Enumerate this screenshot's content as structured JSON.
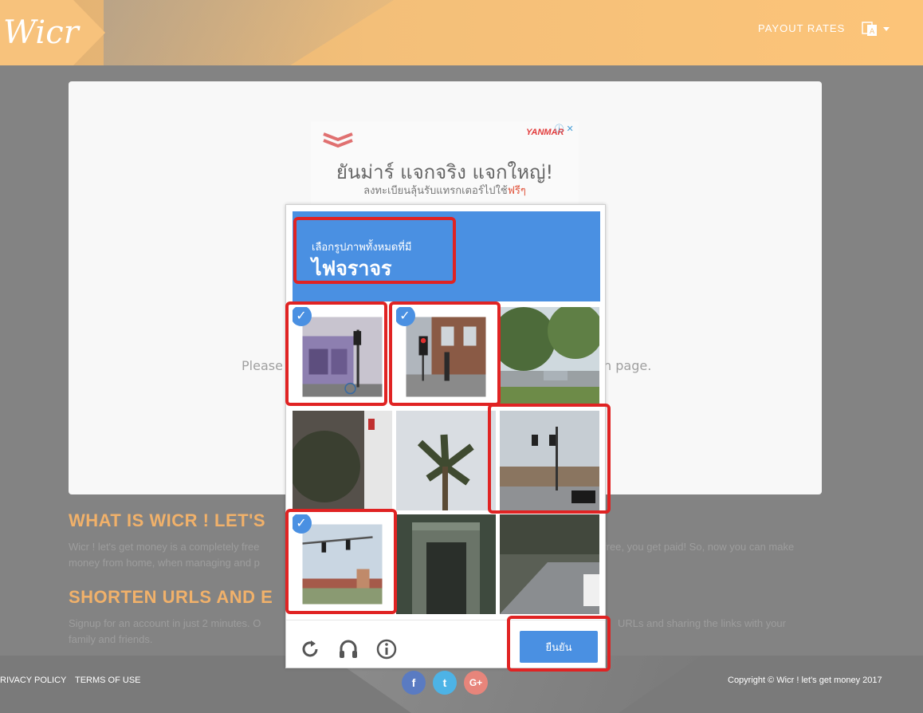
{
  "header": {
    "logo": "Wicr",
    "nav_payout": "PAYOUT RATES",
    "language_icon": "language-icon"
  },
  "main": {
    "message_left": "Please",
    "message_right": "n page."
  },
  "ad": {
    "brand": "YANMAR",
    "headline": "ยันม่าร์ แจกจริง แจกใหญ่!",
    "subline": "ลงทะเบียนลุ้นรับแทรกเตอร์ไปใช้",
    "subline_free": "ฟรีๆ"
  },
  "sections": {
    "what_title": "WHAT IS WICR ! LET'S",
    "what_text_1": "Wicr ! let's get money is a completely free",
    "what_text_1_right": "free, you get paid! So, now you can make",
    "what_text_2": "money from home, when managing and p",
    "shorten_title": "SHORTEN URLS AND E",
    "shorten_text_1": "Signup for an account in just 2 minutes. O",
    "shorten_text_1_right": "URLs and sharing the links with your",
    "shorten_text_2": "family and friends."
  },
  "footer": {
    "privacy": "RIVACY POLICY",
    "terms": "TERMS OF USE",
    "copyright": "Copyright © Wicr ! let's get money 2017",
    "social": [
      "f",
      "t",
      "G+"
    ]
  },
  "captcha": {
    "instruction_sub": "เลือกรูปภาพทั้งหมดที่มี",
    "instruction_main": "ไฟจราจร",
    "verify_label": "ยืนยัน",
    "selected_tiles": [
      0,
      1,
      6
    ],
    "footer_icons": [
      "refresh-icon",
      "headphones-icon",
      "info-icon"
    ]
  },
  "colors": {
    "header": "#fcc479",
    "accent": "#4a90e2",
    "section_title": "#f1b16a",
    "annotation": "#e02323"
  }
}
